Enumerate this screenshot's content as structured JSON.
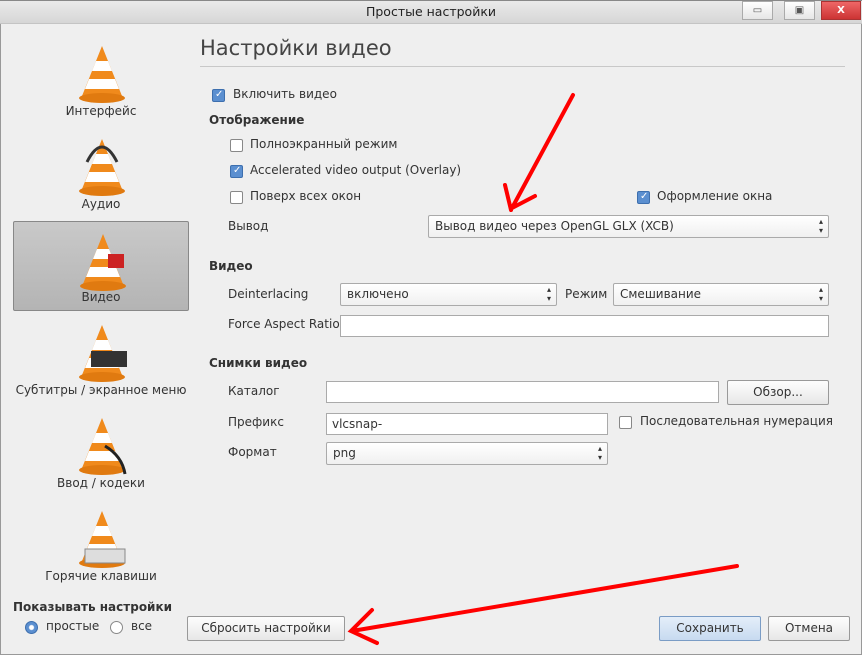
{
  "window": {
    "title": "Простые настройки",
    "minimize": "▭",
    "maximize": "▣",
    "close": "X"
  },
  "sidebar": {
    "items": [
      {
        "label": "Интерфейс",
        "selected": false
      },
      {
        "label": "Аудио",
        "selected": false
      },
      {
        "label": "Видео",
        "selected": true
      },
      {
        "label": "Субтитры / экранное меню",
        "selected": false
      },
      {
        "label": "Ввод / кодеки",
        "selected": false
      },
      {
        "label": "Горячие клавиши",
        "selected": false
      }
    ],
    "show_settings_label": "Показывать настройки",
    "mode_simple": "простые",
    "mode_all": "все",
    "mode_selected": "простые"
  },
  "main": {
    "title": "Настройки видео",
    "enable_video": {
      "label": "Включить видео",
      "checked": true
    },
    "display": {
      "heading": "Отображение",
      "fullscreen": {
        "label": "Полноэкранный режим",
        "checked": false
      },
      "accelerated": {
        "label": "Accelerated video output (Overlay)",
        "checked": true
      },
      "on_top": {
        "label": "Поверх всех окон",
        "checked": false
      },
      "decorations": {
        "label": "Оформление окна",
        "checked": true
      },
      "output_label": "Вывод",
      "output_value": "Вывод видео через OpenGL GLX (XCB)"
    },
    "video": {
      "heading": "Видео",
      "deinterlacing_label": "Deinterlacing",
      "deinterlacing_value": "включено",
      "mode_label": "Режим",
      "mode_value": "Смешивание",
      "aspect_label": "Force Aspect Ratio",
      "aspect_value": ""
    },
    "snapshots": {
      "heading": "Снимки видео",
      "dir_label": "Каталог",
      "dir_value": "",
      "browse": "Обзор...",
      "prefix_label": "Префикс",
      "prefix_value": "vlcsnap-",
      "sequential": {
        "label": "Последовательная нумерация",
        "checked": false
      },
      "format_label": "Формат",
      "format_value": "png"
    }
  },
  "footer": {
    "reset": "Сбросить настройки",
    "save": "Сохранить",
    "cancel": "Отмена"
  },
  "colors": {
    "annotation": "#ff0000",
    "accent": "#5b8fd0"
  }
}
